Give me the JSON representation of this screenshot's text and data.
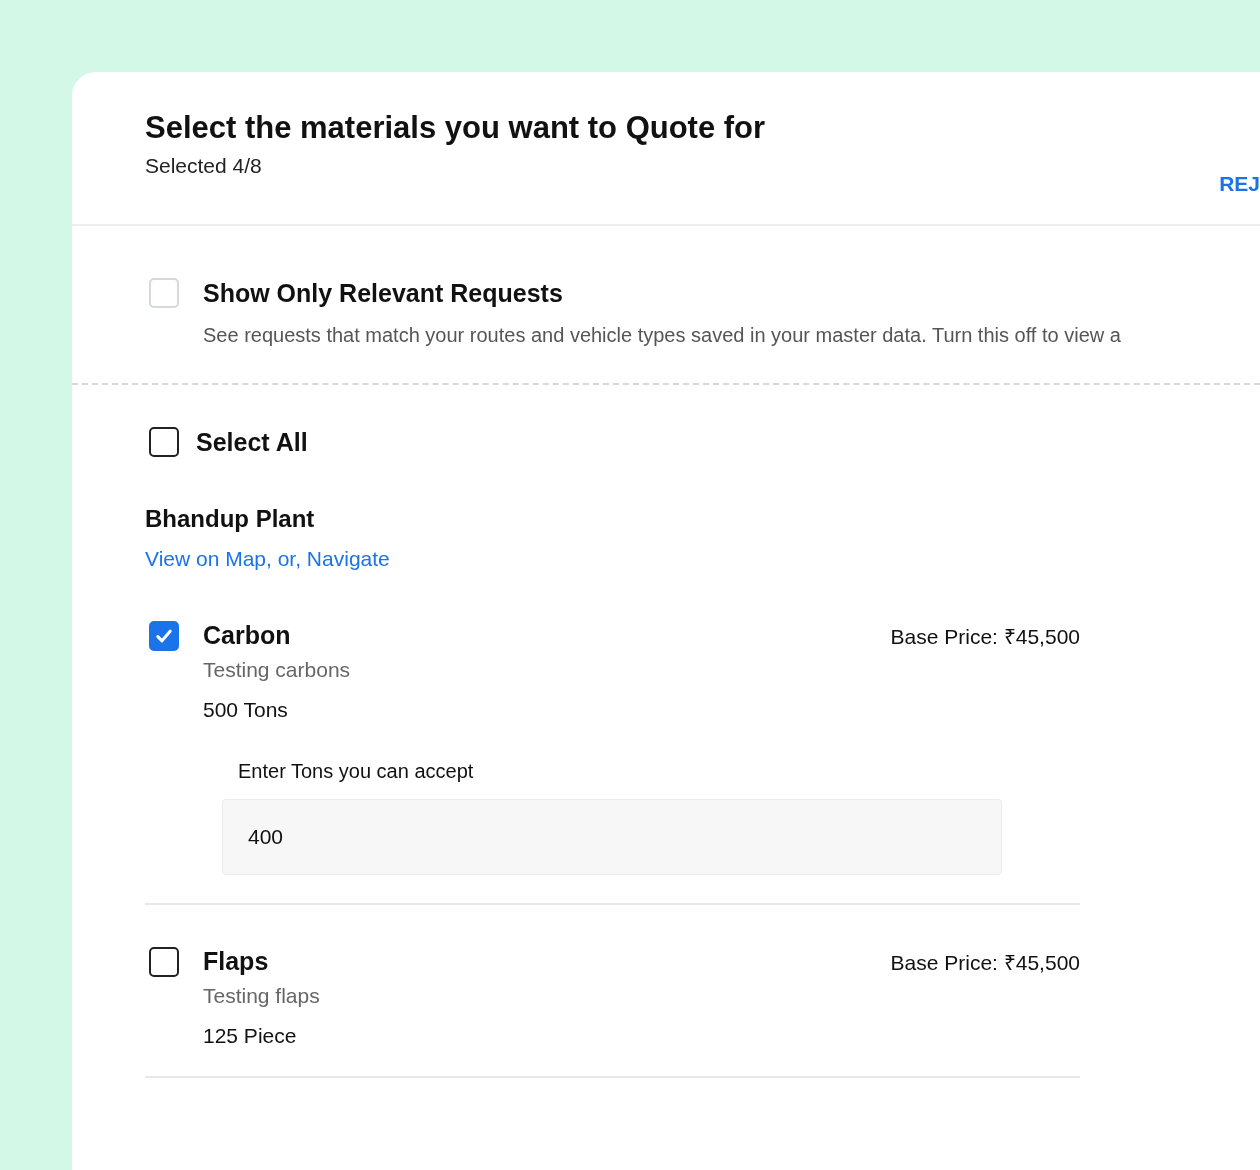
{
  "header": {
    "title": "Select the materials you want to Quote for",
    "selected_count": "Selected 4/8",
    "reject_link": "REJ"
  },
  "relevant_filter": {
    "label": "Show Only Relevant Requests",
    "description": "See requests that match your routes and vehicle types saved in your master data. Turn this off to view a",
    "checked": false
  },
  "select_all": {
    "label": "Select All",
    "checked": false
  },
  "plant": {
    "name": "Bhandup Plant",
    "map_link": "View on Map, or, Navigate"
  },
  "materials": [
    {
      "name": "Carbon",
      "description": "Testing carbons",
      "quantity": "500 Tons",
      "base_price": "Base Price: ₹45,500",
      "checked": true,
      "input": {
        "label": "Enter Tons you can accept",
        "value": "400"
      }
    },
    {
      "name": "Flaps",
      "description": "Testing flaps",
      "quantity": "125 Piece",
      "base_price": "Base Price: ₹45,500",
      "checked": false
    }
  ]
}
